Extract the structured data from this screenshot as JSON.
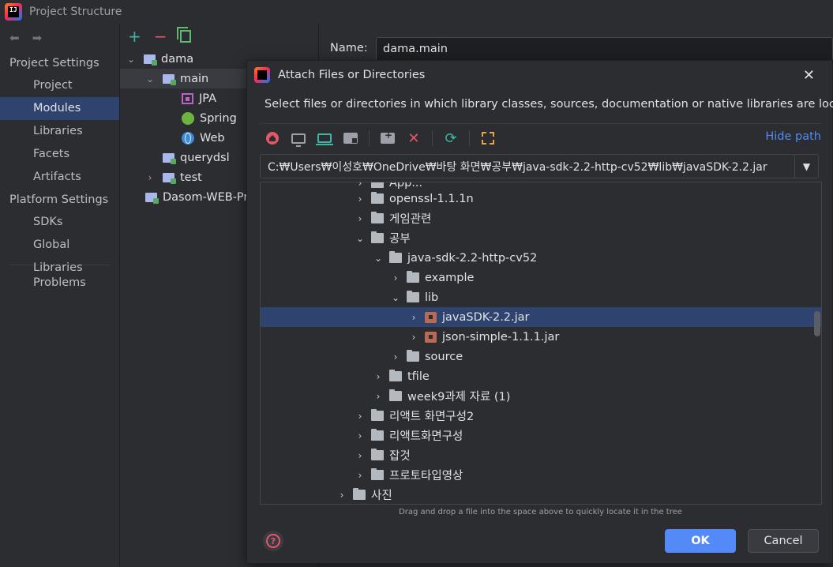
{
  "window": {
    "title": "Project Structure"
  },
  "leftnav": {
    "project_settings": "Project Settings",
    "project_settings_items": [
      "Project",
      "Modules",
      "Libraries",
      "Facets",
      "Artifacts"
    ],
    "platform_settings": "Platform Settings",
    "platform_settings_items": [
      "SDKs",
      "Global Libraries"
    ],
    "problems": "Problems",
    "selected": "Modules"
  },
  "modules_tree": {
    "items": [
      {
        "label": "dama",
        "expanded": true
      },
      {
        "label": "main",
        "expanded": true
      },
      {
        "label": "JPA"
      },
      {
        "label": "Spring"
      },
      {
        "label": "Web"
      },
      {
        "label": "querydsl"
      },
      {
        "label": "test",
        "expanded": false
      },
      {
        "label": "Dasom-WEB-Pro"
      }
    ]
  },
  "module_detail": {
    "name_label": "Name:",
    "name_value": "dama.main"
  },
  "dialog": {
    "title": "Attach Files or Directories",
    "description": "Select files or directories in which library classes, sources, documentation or native libraries are located",
    "hide_path": "Hide path",
    "path": "C:₩Users₩이성호₩OneDrive₩바탕 화면₩공부₩java-sdk-2.2-http-cv52₩lib₩javaSDK-2.2.jar",
    "tree": [
      {
        "label": "App..."
      },
      {
        "label": "openssl-1.1.1n"
      },
      {
        "label": "게임관련"
      },
      {
        "label": "공부"
      },
      {
        "label": "java-sdk-2.2-http-cv52"
      },
      {
        "label": "example"
      },
      {
        "label": "lib"
      },
      {
        "label": "javaSDK-2.2.jar"
      },
      {
        "label": "json-simple-1.1.1.jar"
      },
      {
        "label": "source"
      },
      {
        "label": "tfile"
      },
      {
        "label": "week9과제 자료 (1)"
      },
      {
        "label": "리액트 화면구성2"
      },
      {
        "label": "리액트화면구성"
      },
      {
        "label": "잡것"
      },
      {
        "label": "프로토타입영상"
      },
      {
        "label": "사진"
      }
    ],
    "drag_hint": "Drag and drop a file into the space above to quickly locate it in the tree",
    "ok": "OK",
    "cancel": "Cancel"
  },
  "colors": {
    "accent": "#548af7",
    "selection": "#2e436e",
    "background": "#2b2d30"
  }
}
